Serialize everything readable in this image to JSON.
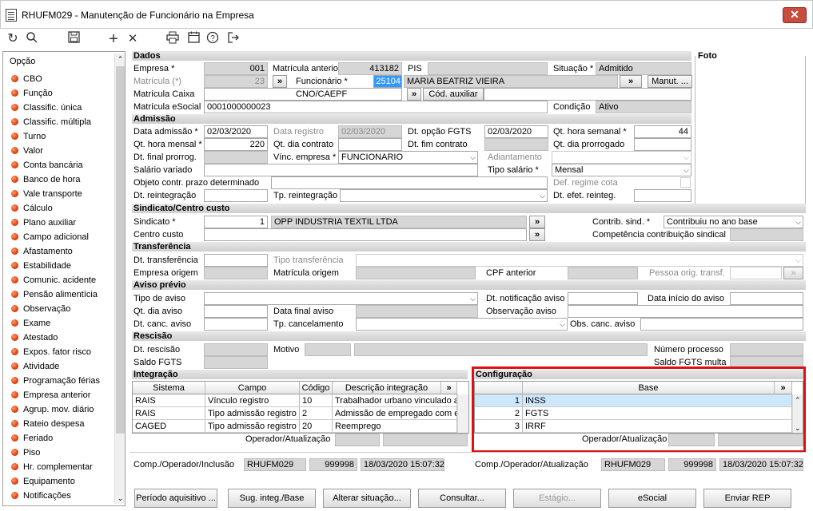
{
  "window": {
    "title": "RHUFM029 - Manutenção de Funcionário na Empresa",
    "close": "✕"
  },
  "toolbar": {
    "refresh": "↻",
    "search": "🔍",
    "save": "💾",
    "add": "+",
    "delete": "✕",
    "print": "🖶",
    "calendar": "📅",
    "help": "?",
    "exit": "⇥"
  },
  "sidebar": {
    "header": "Opção",
    "items": [
      "CBO",
      "Função",
      "Classific. única",
      "Classific. múltipla",
      "Turno",
      "Valor",
      "Conta bancária",
      "Banco de hora",
      "Vale transporte",
      "Cálculo",
      "Plano auxiliar",
      "Campo adicional",
      "Afastamento",
      "Estabilidade",
      "Comunic. acidente",
      "Pensão alimentícia",
      "Observação",
      "Exame",
      "Atestado",
      "Expos. fator risco",
      "Atividade",
      "Programação férias",
      "Empresa anterior",
      "Agrup. mov. diário",
      "Rateio despesa",
      "Feriado",
      "Piso",
      "Hr. complementar",
      "Equipamento",
      "Notificações"
    ]
  },
  "sections": {
    "dados": "Dados",
    "foto": "Foto",
    "admissao": "Admissão",
    "sindicato": "Sindicato/Centro custo",
    "transferencia": "Transferência",
    "aviso": "Aviso prévio",
    "rescisao": "Rescisão",
    "integracao": "Integração",
    "configuracao": "Configuração"
  },
  "dados": {
    "empresa_label": "Empresa *",
    "empresa": "001",
    "matricula_label": "Matrícula (*)",
    "matricula": "23",
    "matricula_caixa_label": "Matrícula Caixa",
    "matricula_esocial_label": "Matrícula eSocial",
    "matricula_esocial": "0001000000023",
    "mat_anterior_label": "Matrícula anterior",
    "mat_anterior": "413182",
    "funcionario_label": "Funcionário *",
    "funcionario_code": "25104",
    "funcionario_name": "MARIA BEATRIZ VIEIRA",
    "cno_label": "CNO/CAEPF",
    "cod_aux": "Cód. auxiliar",
    "pis_label": "PIS",
    "situacao_label": "Situação *",
    "situacao": "Admitido",
    "manut": "Manut. ...",
    "condicao_label": "Condição",
    "condicao": "Ativo",
    "arrow": "»"
  },
  "admissao": {
    "data_adm_label": "Data admissão *",
    "data_adm": "02/03/2020",
    "data_reg_label": "Data registro",
    "data_reg": "02/03/2020",
    "opcao_fgts_label": "Dt. opção FGTS",
    "opcao_fgts": "02/03/2020",
    "hora_sem_label": "Qt. hora semanal *",
    "hora_sem": "44",
    "hora_mens_label": "Qt. hora mensal *",
    "hora_mens": "220",
    "dia_contr_label": "Qt. dia contrato",
    "fim_contr_label": "Dt. fim contrato",
    "dia_prorr_label": "Qt. dia prorrogado",
    "final_prorr_label": "Dt. final prorrog.",
    "vinc_label": "Vínc. empresa *",
    "vinc": "FUNCIONARIO",
    "adiantamento_label": "Adiantamento",
    "salario_var_label": "Salário variado",
    "tipo_sal_label": "Tipo salário *",
    "tipo_sal": "Mensal",
    "objeto_label": "Objeto contr. prazo determinado",
    "regime_label": "Def. regime cota",
    "reint_label": "Dt. reintegração",
    "tp_reint_label": "Tp. reintegração",
    "efet_reint_label": "Dt. efet. reinteg."
  },
  "sindicato": {
    "sind_label": "Sindicato *",
    "sind_code": "1",
    "sind_name": "OPP INDUSTRIA TEXTIL LTDA",
    "contrib_label": "Contrib. sind. *",
    "contrib": "Contribuiu no ano base",
    "centro_label": "Centro custo",
    "comp_label": "Competência contribuição sindical"
  },
  "transferencia": {
    "dt_label": "Dt. transferência",
    "tipo_label": "Tipo transferência",
    "emp_orig_label": "Empresa origem",
    "mat_orig_label": "Matrícula origem",
    "cpf_label": "CPF anterior",
    "pessoa_label": "Pessoa orig. transf."
  },
  "aviso": {
    "tipo_label": "Tipo de aviso",
    "notif_label": "Dt. notificação aviso",
    "inicio_label": "Data início do aviso",
    "qt_dia_label": "Qt. dia aviso",
    "final_label": "Data final aviso",
    "obs_label": "Observação aviso",
    "canc_label": "Dt. canc. aviso",
    "tp_canc_label": "Tp. cancelamento",
    "obs_canc_label": "Obs. canc. aviso"
  },
  "rescisao": {
    "dt_label": "Dt. rescisão",
    "motivo_label": "Motivo",
    "processo_label": "Número processo",
    "saldo_label": "Saldo FGTS",
    "saldo_multa_label": "Saldo FGTS multa"
  },
  "integracao": {
    "headers": [
      "Sistema",
      "Campo",
      "Código",
      "Descrição integração"
    ],
    "rows": [
      [
        "RAIS",
        "Vínculo registro",
        "10",
        "Trabalhador urbano vinculado a"
      ],
      [
        "RAIS",
        "Tipo admissão registro",
        "2",
        "Admissão de empregado com e"
      ],
      [
        "CAGED",
        "Tipo admissão registro",
        "20",
        "Reemprego"
      ]
    ],
    "operador_label": "Operador/Atualização"
  },
  "configuracao": {
    "header": "Base",
    "rows": [
      [
        "1",
        "INSS"
      ],
      [
        "2",
        "FGTS"
      ],
      [
        "3",
        "IRRF"
      ]
    ],
    "operador_label": "Operador/Atualização"
  },
  "footer": {
    "inclusao_label": "Comp./Operador/Inclusão",
    "inc_comp": "RHUFM029",
    "inc_oper": "999998",
    "inc_date": "18/03/2020 15:07:32",
    "atual_label": "Comp./Operador/Atualização",
    "at_comp": "RHUFM029",
    "at_oper": "999998",
    "at_date": "18/03/2020 15:07:32"
  },
  "buttons": [
    "Período aquisitivo ...",
    "Sug. integ./Base",
    "Alterar situação...",
    "Consultar...",
    "Estágio...",
    "eSocial",
    "Enviar REP"
  ]
}
